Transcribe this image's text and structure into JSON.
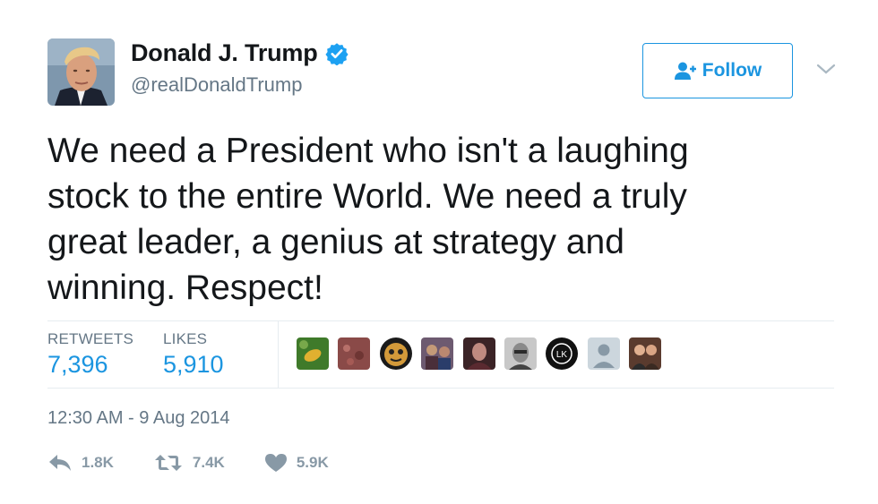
{
  "author": {
    "name": "Donald J. Trump",
    "handle": "@realDonaldTrump",
    "verified": true
  },
  "follow_button": {
    "label": "Follow"
  },
  "tweet": {
    "lines": [
      "We need a President who isn't a laughing",
      "stock to the entire World. We need a truly",
      "great leader, a genius at strategy and",
      "winning. Respect!"
    ]
  },
  "stats": {
    "retweets_label": "RETWEETS",
    "retweets_value": "7,396",
    "likes_label": "LIKES",
    "likes_value": "5,910"
  },
  "likers": [
    {
      "icon": "liker-avatar-1"
    },
    {
      "icon": "liker-avatar-2"
    },
    {
      "icon": "liker-avatar-3"
    },
    {
      "icon": "liker-avatar-4"
    },
    {
      "icon": "liker-avatar-5"
    },
    {
      "icon": "liker-avatar-6"
    },
    {
      "icon": "liker-avatar-7",
      "initials": "LK"
    },
    {
      "icon": "liker-avatar-8"
    },
    {
      "icon": "liker-avatar-9"
    }
  ],
  "timestamp": "12:30 AM - 9 Aug 2014",
  "actions": {
    "reply_count": "1.8K",
    "retweet_count": "7.4K",
    "like_count": "5.9K"
  },
  "colors": {
    "accent": "#1b95e0",
    "muted": "#657786",
    "action_gray": "#8899a6",
    "divider": "#e6ecf0"
  }
}
